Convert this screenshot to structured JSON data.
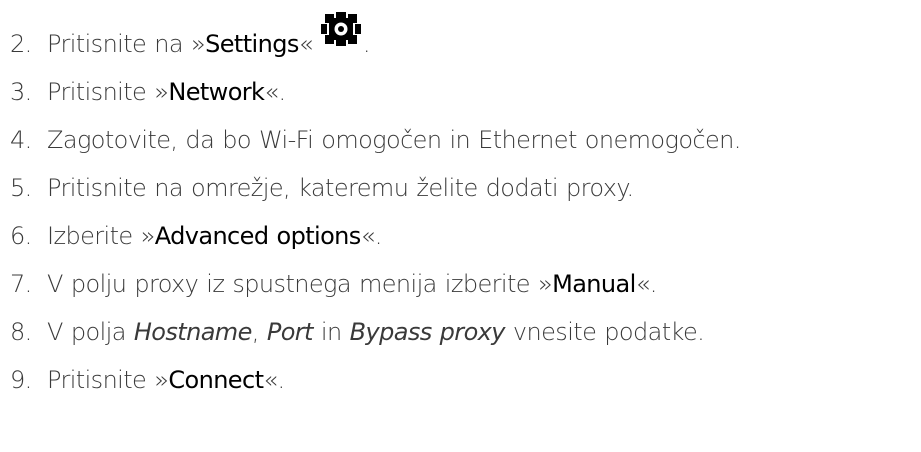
{
  "steps": [
    {
      "num": "2.",
      "pre": "Pritisnite na »",
      "bold": "Settings",
      "post": "«",
      "icon": "gear-icon",
      "end": "."
    },
    {
      "num": "3.",
      "pre": "Pritisnite »",
      "bold": "Network",
      "post": "«."
    },
    {
      "num": "4.",
      "text": "Zagotovite, da bo Wi-Fi omogočen in Ethernet onemogočen."
    },
    {
      "num": "5.",
      "text": "Pritisnite na omrežje, kateremu želite dodati proxy."
    },
    {
      "num": "6.",
      "pre": "Izberite »",
      "bold": "Advanced options",
      "post": "«."
    },
    {
      "num": "7.",
      "pre": "V polju proxy iz spustnega menija izberite »",
      "bold": "Manual",
      "post": "«."
    },
    {
      "num": "8.",
      "pre": "V polja ",
      "italic1": "Hostname",
      "sep1": ", ",
      "italic2": "Port",
      "sep2": " in ",
      "italic3": "Bypass proxy",
      "post": " vnesite podatke."
    },
    {
      "num": "9.",
      "pre": "Pritisnite »",
      "bold": "Connect",
      "post": "«."
    }
  ]
}
